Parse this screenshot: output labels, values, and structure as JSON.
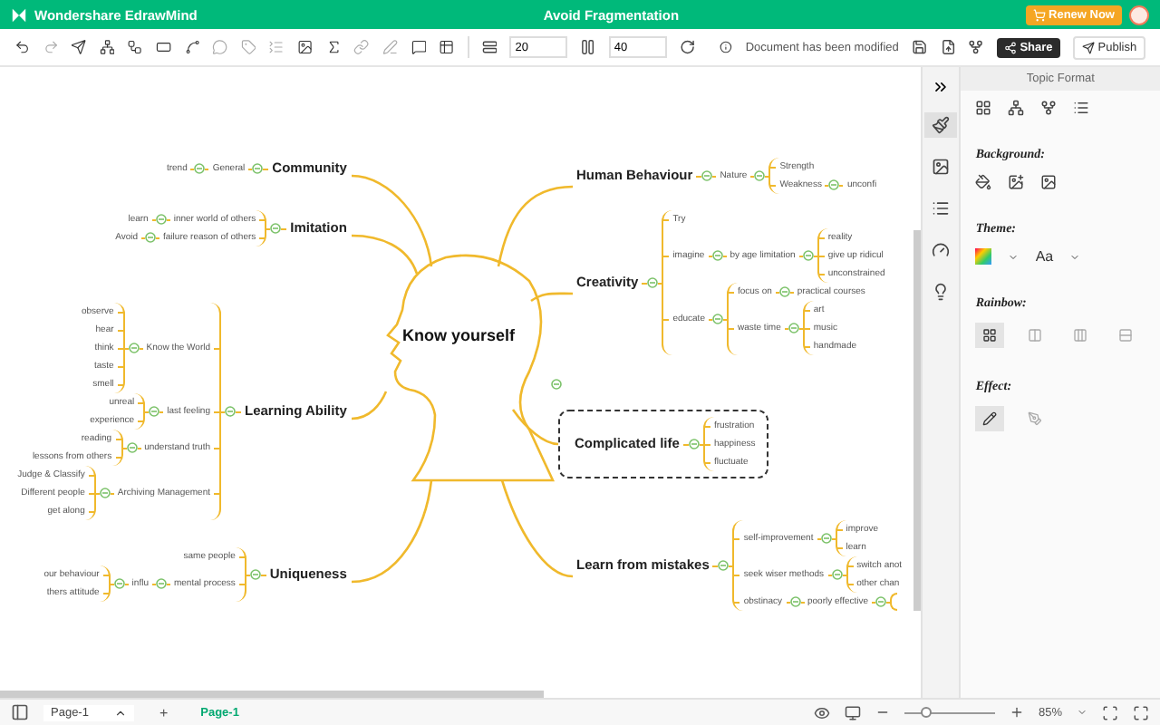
{
  "app": {
    "name": "Wondershare EdrawMind",
    "document_title": "Avoid Fragmentation",
    "renew_button": "Renew Now"
  },
  "toolbar": {
    "spacing_horizontal": "20",
    "spacing_vertical": "40",
    "status": "Document has been modified",
    "share_button": "Share",
    "publish_button": "Publish"
  },
  "mind_map": {
    "central_topic": "Know yourself",
    "left_branches": [
      {
        "text": "Community",
        "children": [
          {
            "text": "General",
            "children": [
              {
                "text": "trend"
              }
            ]
          }
        ]
      },
      {
        "text": "Imitation",
        "children": [
          {
            "text": "inner world of others",
            "children": [
              {
                "text": "learn"
              }
            ]
          },
          {
            "text": "failure reason of others",
            "children": [
              {
                "text": "Avoid"
              }
            ]
          }
        ]
      },
      {
        "text": "Learning Ability",
        "children": [
          {
            "text": "Know the World",
            "children": [
              {
                "text": "observe"
              },
              {
                "text": "hear"
              },
              {
                "text": "think"
              },
              {
                "text": "taste"
              },
              {
                "text": "smell"
              }
            ]
          },
          {
            "text": "last feeling",
            "children": [
              {
                "text": "unreal"
              },
              {
                "text": "experience"
              }
            ]
          },
          {
            "text": "understand truth",
            "children": [
              {
                "text": "reading"
              },
              {
                "text": "lessons from others"
              }
            ]
          },
          {
            "text": "Archiving Management",
            "children": [
              {
                "text": "Judge & Classify"
              },
              {
                "text": "Different people"
              },
              {
                "text": "get along"
              }
            ]
          }
        ]
      },
      {
        "text": "Uniqueness",
        "children": [
          {
            "text": "same people"
          },
          {
            "text": "mental process",
            "children": [
              {
                "text": "influ",
                "children": [
                  {
                    "text": "our behaviour"
                  },
                  {
                    "text": "thers attitude"
                  }
                ]
              }
            ]
          }
        ]
      }
    ],
    "right_branches": [
      {
        "text": "Human Behaviour",
        "children": [
          {
            "text": "Nature",
            "children": [
              {
                "text": "Strength"
              },
              {
                "text": "Weakness",
                "children": [
                  {
                    "text": "unconfi"
                  }
                ]
              }
            ]
          }
        ]
      },
      {
        "text": "Creativity",
        "children": [
          {
            "text": "Try"
          },
          {
            "text": "imagine",
            "children": [
              {
                "text": "by age limitation",
                "children": [
                  {
                    "text": "reality"
                  },
                  {
                    "text": "give up ridicul"
                  },
                  {
                    "text": "unconstrained"
                  }
                ]
              }
            ]
          },
          {
            "text": "educate",
            "children": [
              {
                "text": "focus on",
                "children": [
                  {
                    "text": "practical courses"
                  }
                ]
              },
              {
                "text": "waste time",
                "children": [
                  {
                    "text": "art"
                  },
                  {
                    "text": "music"
                  },
                  {
                    "text": "handmade"
                  }
                ]
              }
            ]
          }
        ]
      },
      {
        "text": "Complicated life",
        "boundary": true,
        "children": [
          {
            "text": "frustration"
          },
          {
            "text": "happiness"
          },
          {
            "text": "fluctuate"
          }
        ]
      },
      {
        "text": "Learn from mistakes",
        "children": [
          {
            "text": "self-improvement",
            "children": [
              {
                "text": "improve"
              },
              {
                "text": "learn"
              }
            ]
          },
          {
            "text": "seek wiser methods",
            "children": [
              {
                "text": "switch anot"
              },
              {
                "text": "other chan"
              }
            ]
          },
          {
            "text": "obstinacy",
            "children": [
              {
                "text": "poorly effective",
                "more": true
              }
            ]
          }
        ]
      }
    ]
  },
  "side_tabs": [
    {
      "kind": "format",
      "selected": true
    },
    {
      "kind": "image",
      "selected": false
    },
    {
      "kind": "outline",
      "selected": false
    },
    {
      "kind": "theme",
      "selected": false
    },
    {
      "kind": "idea",
      "selected": false
    }
  ],
  "format_panel": {
    "title": "Topic Format",
    "background": {
      "title": "Background:"
    },
    "theme": {
      "title": "Theme:",
      "font_label": "Aa"
    },
    "rainbow": {
      "title": "Rainbow:",
      "options": [
        {
          "selected": true
        },
        {
          "selected": false
        },
        {
          "selected": false
        },
        {
          "selected": false
        }
      ]
    },
    "effect": {
      "title": "Effect:",
      "options": [
        {
          "selected": true
        },
        {
          "selected": false
        }
      ]
    }
  },
  "status_bar": {
    "page_selector": "Page-1",
    "add_button": "+",
    "tabs": [
      {
        "label": "Page-1",
        "selected": true
      }
    ],
    "zoom": {
      "level": 0.25,
      "reading": "85%"
    }
  }
}
